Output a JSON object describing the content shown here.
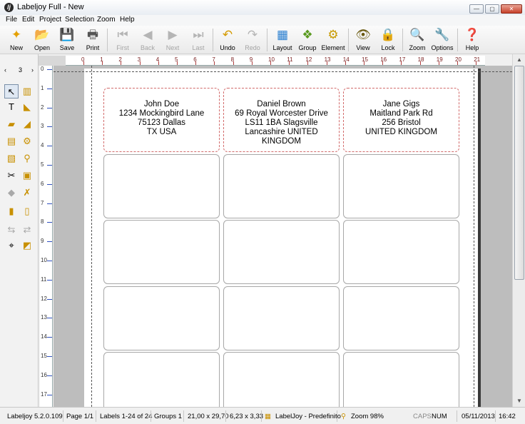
{
  "window": {
    "title": "Labeljoy Full - New",
    "controls": {
      "minimize": "—",
      "maximize": "▢",
      "close": "✕"
    }
  },
  "menu": [
    "File",
    "Edit",
    "Project",
    "Selection",
    "Zoom",
    "Help"
  ],
  "toolbar": {
    "buttons": [
      {
        "label": "New",
        "icon": "new-icon",
        "enabled": true
      },
      {
        "label": "Open",
        "icon": "open-icon",
        "enabled": true
      },
      {
        "label": "Save",
        "icon": "save-icon",
        "enabled": true
      },
      {
        "label": "Print",
        "icon": "print-icon",
        "enabled": true
      },
      {
        "label": "First",
        "icon": "first-icon",
        "enabled": false
      },
      {
        "label": "Back",
        "icon": "back-icon",
        "enabled": false
      },
      {
        "label": "Next",
        "icon": "next-icon",
        "enabled": false
      },
      {
        "label": "Last",
        "icon": "last-icon",
        "enabled": false
      },
      {
        "label": "Undo",
        "icon": "undo-icon",
        "enabled": true
      },
      {
        "label": "Redo",
        "icon": "redo-icon",
        "enabled": false
      },
      {
        "label": "Layout",
        "icon": "layout-icon",
        "enabled": true
      },
      {
        "label": "Group",
        "icon": "group-icon",
        "enabled": true
      },
      {
        "label": "Element",
        "icon": "element-icon",
        "enabled": true
      },
      {
        "label": "View",
        "icon": "view-icon",
        "enabled": true
      },
      {
        "label": "Lock",
        "icon": "lock-icon",
        "enabled": true
      },
      {
        "label": "Zoom",
        "icon": "zoom-icon",
        "enabled": true
      },
      {
        "label": "Options",
        "icon": "options-icon",
        "enabled": true
      },
      {
        "label": "Help",
        "icon": "help-icon",
        "enabled": true
      }
    ]
  },
  "palette": {
    "page_number": "3",
    "tools": [
      "select-tool-icon",
      "barcode-tool-icon",
      "text-tool-icon",
      "image-tool-icon",
      "shape-tool-icon",
      "line-tool-icon",
      "database-tool-icon",
      "counter-tool-icon",
      "cut-tool-icon",
      "copy-tool-icon",
      "paste-tool-icon",
      "delete-tool-icon",
      "bring-front-icon",
      "send-back-icon",
      "align-icon",
      "swap-icon",
      "position-icon",
      "rotate-icon"
    ]
  },
  "ruler": {
    "h_labels": [
      "0",
      "1",
      "2",
      "3",
      "4",
      "5",
      "6",
      "7",
      "8",
      "9",
      "10",
      "11",
      "12",
      "13",
      "14",
      "15",
      "16",
      "17",
      "18",
      "19",
      "20",
      "21"
    ],
    "v_labels": [
      "0",
      "1",
      "2",
      "3",
      "4",
      "5",
      "6",
      "7",
      "8",
      "9",
      "10",
      "11",
      "12",
      "13",
      "14",
      "15",
      "16",
      "17"
    ]
  },
  "labels": [
    {
      "lines": [
        "John Doe",
        "1234 Mockingbird Lane",
        "75123 Dallas",
        "TX USA"
      ]
    },
    {
      "lines": [
        "Daniel Brown",
        "69 Royal Worcester Drive",
        "LS11 1BA Slagsville",
        "Lancashire UNITED",
        "KINGDOM"
      ]
    },
    {
      "lines": [
        "Jane Gigs",
        "Maitland Park Rd",
        "256 Bristol",
        "UNITED KINGDOM"
      ]
    },
    {
      "lines": []
    },
    {
      "lines": []
    },
    {
      "lines": []
    },
    {
      "lines": []
    },
    {
      "lines": []
    },
    {
      "lines": []
    },
    {
      "lines": []
    },
    {
      "lines": []
    },
    {
      "lines": []
    },
    {
      "lines": []
    },
    {
      "lines": []
    },
    {
      "lines": []
    }
  ],
  "status": {
    "version": "Labeljoy 5.2.0.109",
    "page": "Page 1/1",
    "labels": "Labels 1-24 of 24",
    "groups": "Groups 1",
    "page_size": "21,00 x 29,70",
    "label_size": "6,23 x 3,33",
    "layout": "LabelJoy - Predefinito",
    "zoom": "Zoom 98%",
    "caps": "CAPS",
    "num": "NUM",
    "date": "05/11/2013",
    "time": "16:42"
  },
  "colors": {
    "label_border_filled": "#d26a6a",
    "ruler_marks": "#7a2020",
    "canvas_background": "#bdbdbd"
  }
}
